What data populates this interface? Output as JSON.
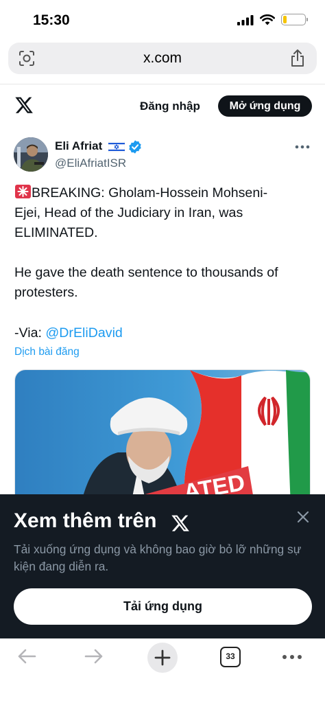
{
  "status_bar": {
    "time": "15:30",
    "battery_level": 0.18
  },
  "browser": {
    "url": "x.com",
    "tab_count": "33"
  },
  "header": {
    "login_label": "Đăng nhập",
    "open_app_label": "Mở ứng dụng"
  },
  "tweet": {
    "author_name": "Eli Afriat",
    "author_handle": "@EliAfriatISR",
    "line1": "BREAKING: Gholam-Hossein Mohseni-",
    "line2": "Ejei, Head of the Judiciary in Iran, was",
    "line3": "ELIMINATED.",
    "line4": "He gave the death sentence to thousands of",
    "line5": "protesters.",
    "via_prefix": "-Via: ",
    "via_mention": "@DrEliDavid",
    "translate_label": "Dịch bài đăng",
    "media_overlay_text": "ATED"
  },
  "sheet": {
    "title": "Xem thêm trên",
    "description": "Tải xuống ứng dụng và không bao giờ bỏ lỡ những sự kiện đang diễn ra.",
    "button_label": "Tải ứng dụng"
  },
  "colors": {
    "accent": "#1d9bf0",
    "sheet_bg": "#141b23",
    "text": "#0f1419",
    "muted": "#536471"
  }
}
